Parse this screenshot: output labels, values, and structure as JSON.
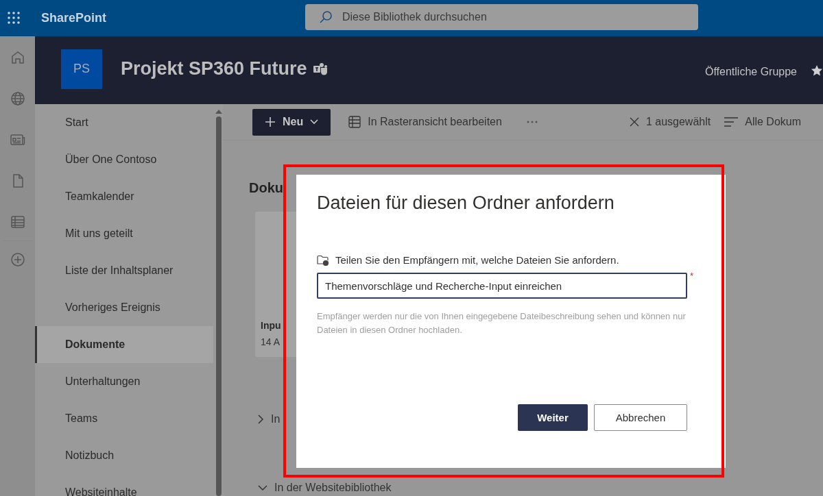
{
  "app_bar": {
    "app_name": "SharePoint",
    "search": {
      "placeholder": "Diese Bibliothek durchsuchen"
    }
  },
  "site_header": {
    "logo": "PS",
    "title": "Projekt SP360 Future",
    "privacy": "Öffentliche Gruppe"
  },
  "nav": {
    "items": [
      {
        "label": "Start",
        "selected": false
      },
      {
        "label": "Über One Contoso",
        "selected": false
      },
      {
        "label": "Teamkalender",
        "selected": false
      },
      {
        "label": "Mit uns geteilt",
        "selected": false
      },
      {
        "label": "Liste der Inhaltsplaner",
        "selected": false
      },
      {
        "label": "Vorheriges Ereignis",
        "selected": false
      },
      {
        "label": "Dokumente",
        "selected": true
      },
      {
        "label": "Unterhaltungen",
        "selected": false
      },
      {
        "label": "Teams",
        "selected": false
      },
      {
        "label": "Notizbuch",
        "selected": false
      },
      {
        "label": "Websiteinhalte",
        "selected": false
      }
    ]
  },
  "command_bar": {
    "new_button": "Neu",
    "grid_edit": "In Rasteransicht bearbeiten",
    "selection": "1 ausgewählt",
    "view": "Alle Dokum"
  },
  "library": {
    "heading": "Doku",
    "card": {
      "title": "Inpu",
      "date": "14 A"
    },
    "sections": [
      {
        "label": "In",
        "expanded": false
      },
      {
        "label": "In der Websitebibliothek",
        "expanded": true
      }
    ]
  },
  "dialog": {
    "title": "Dateien für diesen Ordner anfordern",
    "prompt": "Teilen Sie den Empfängern mit, welche Dateien Sie anfordern.",
    "field": {
      "value": "Themenvorschläge und Recherche-Input einreichen",
      "required_mark": "*"
    },
    "help": "Empfänger werden nur die von Ihnen eingegebene Dateibeschreibung sehen und können nur Dateien in diesen Ordner hochladen.",
    "buttons": [
      {
        "label": "Weiter",
        "kind": "primary"
      },
      {
        "label": "Abbrechen",
        "kind": "secondary"
      }
    ]
  }
}
